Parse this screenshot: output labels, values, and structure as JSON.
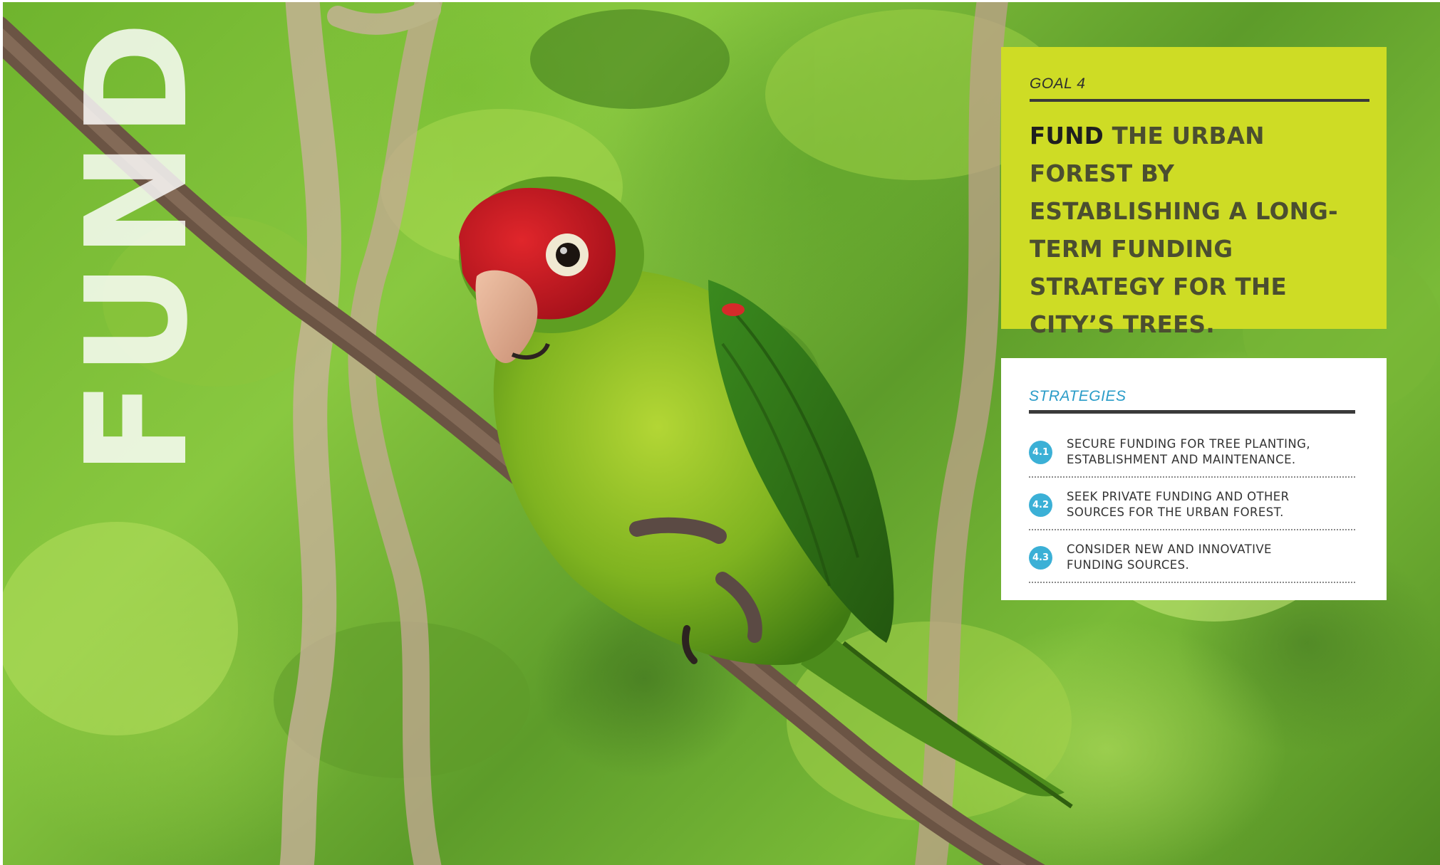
{
  "side_word": "FUND",
  "goal": {
    "label": "GOAL 4",
    "title_lead": "FUND",
    "title_rest": " THE URBAN FOREST BY ESTABLISHING A LONG-TERM FUNDING STRATEGY FOR THE CITY’S TREES."
  },
  "strategies": {
    "label": "STRATEGIES",
    "items": [
      {
        "number": "4.1",
        "text": "SECURE FUNDING FOR TREE PLANTING,\nESTABLISHMENT AND MAINTENANCE."
      },
      {
        "number": "4.2",
        "text": "SEEK PRIVATE FUNDING AND OTHER\nSOURCES FOR THE URBAN FOREST."
      },
      {
        "number": "4.3",
        "text": "CONSIDER NEW AND INNOVATIVE\nFUNDING SOURCES."
      }
    ]
  },
  "colors": {
    "goal_card": "#cedc25",
    "strategy_accent": "#3bb0d6",
    "foliage": "#6fb42e"
  }
}
